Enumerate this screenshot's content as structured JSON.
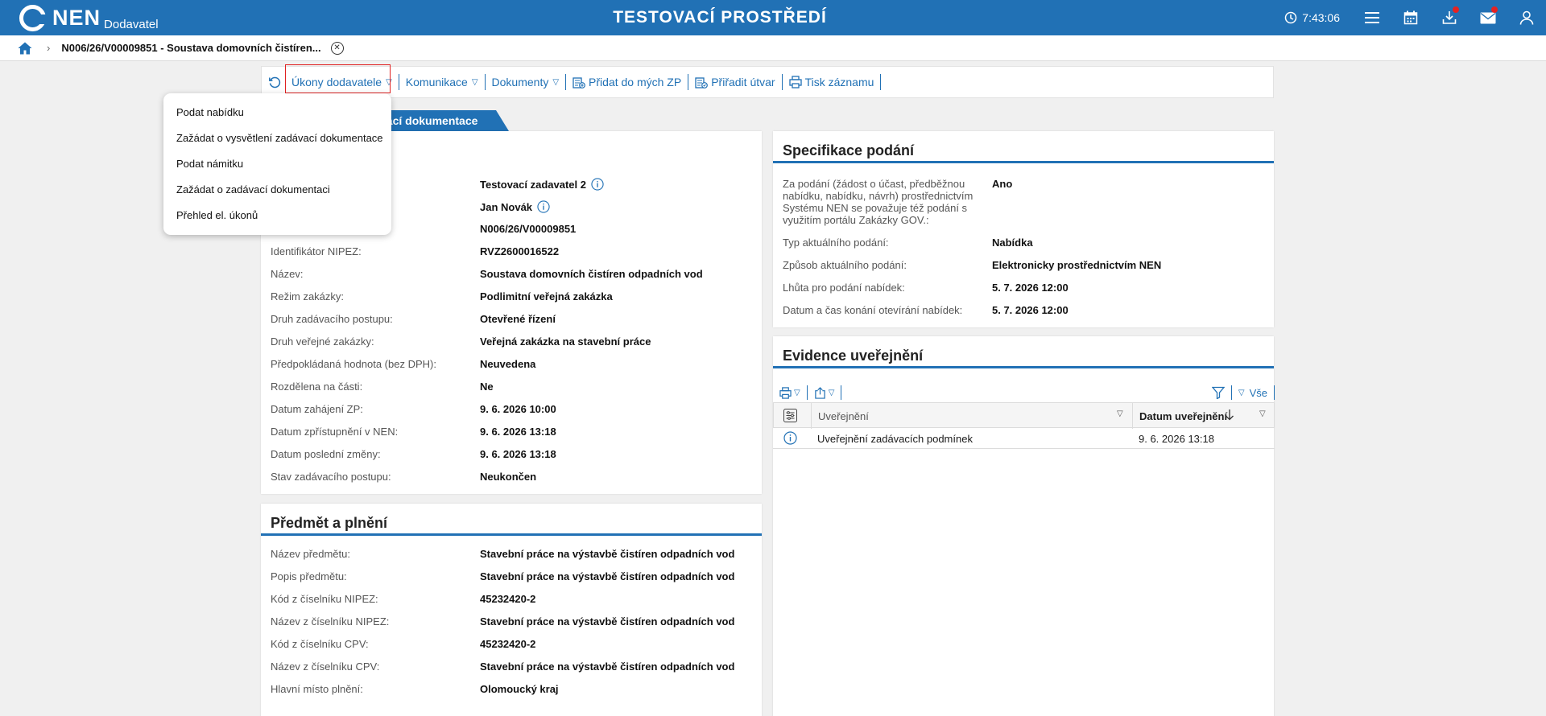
{
  "header": {
    "logo_text": "NEN",
    "logo_sub": "Dodavatel",
    "env_title": "TESTOVACÍ PROSTŘEDÍ",
    "time": "7:43:06",
    "colors": {
      "primary": "#2171b5",
      "badge": "#e52222"
    }
  },
  "breadcrumb": {
    "title": "N006/26/V00009851 - Soustava domovních čistíren..."
  },
  "toolbar": {
    "items": [
      {
        "label": "Úkony dodavatele",
        "icon": "none"
      },
      {
        "label": "Komunikace",
        "icon": "none"
      },
      {
        "label": "Dokumenty",
        "icon": "none"
      },
      {
        "label": "Přidat do mých ZP",
        "icon": "add-to-list-icon"
      },
      {
        "label": "Přiřadit útvar",
        "icon": "assign-unit-icon"
      },
      {
        "label": "Tisk záznamu",
        "icon": "print-icon"
      }
    ]
  },
  "tab": {
    "label": "vací dokumentace"
  },
  "menu": {
    "items": [
      "Podat nabídku",
      "Zažádat o vysvětlení zadávací dokumentace",
      "Podat námitku",
      "Zažádat o zadávací dokumentaci",
      "Přehled el. úkonů"
    ]
  },
  "main_panel": {
    "rows": [
      {
        "k": "",
        "v": "Testovací zadavatel 2"
      },
      {
        "k": "",
        "v": "Jan Novák"
      },
      {
        "k": "",
        "v": "N006/26/V00009851"
      },
      {
        "k": "Identifikátor NIPEZ:",
        "v": "RVZ2600016522"
      },
      {
        "k": "Název:",
        "v": "Soustava domovních čistíren odpadních vod"
      },
      {
        "k": "Režim zakázky:",
        "v": "Podlimitní veřejná zakázka"
      },
      {
        "k": "Druh zadávacího postupu:",
        "v": "Otevřené řízení"
      },
      {
        "k": "Druh veřejné zakázky:",
        "v": "Veřejná zakázka na stavební práce"
      },
      {
        "k": "Předpokládaná hodnota (bez DPH):",
        "v": "Neuvedena"
      },
      {
        "k": "Rozdělena na části:",
        "v": "Ne"
      },
      {
        "k": "Datum zahájení ZP:",
        "v": "9. 6. 2026 10:00"
      },
      {
        "k": "Datum zpřístupnění v NEN:",
        "v": "9. 6. 2026 13:18"
      },
      {
        "k": "Datum poslední změny:",
        "v": "9. 6. 2026 13:18"
      },
      {
        "k": "Stav zadávacího postupu:",
        "v": "Neukončen"
      }
    ]
  },
  "predmet": {
    "title": "Předmět a plnění",
    "rows": [
      {
        "k": "Název předmětu:",
        "v": "Stavební práce na výstavbě čistíren odpadních vod"
      },
      {
        "k": "Popis předmětu:",
        "v": "Stavební práce na výstavbě čistíren odpadních vod"
      },
      {
        "k": "Kód z číselníku NIPEZ:",
        "v": "45232420-2"
      },
      {
        "k": "Název z číselníku NIPEZ:",
        "v": "Stavební práce na výstavbě čistíren odpadních vod"
      },
      {
        "k": "Kód z číselníku CPV:",
        "v": "45232420-2"
      },
      {
        "k": "Název z číselníku CPV:",
        "v": "Stavební práce na výstavbě čistíren odpadních vod"
      },
      {
        "k": "Hlavní místo plnění:",
        "v": "Olomoucký kraj"
      }
    ]
  },
  "specifikace": {
    "title": "Specifikace podání",
    "first_key_lines": [
      "Za podání (žádost o účast, předběžnou",
      "nabídku, nabídku, návrh) prostřednictvím",
      "Systému NEN se považuje též podání s",
      "využitím portálu Zakázky GOV.:"
    ],
    "first_value": "Ano",
    "rows": [
      {
        "k": "Typ aktuálního podání:",
        "v": "Nabídka"
      },
      {
        "k": "Způsob aktuálního podání:",
        "v": "Elektronicky prostřednictvím NEN"
      },
      {
        "k": "Lhůta pro podání nabídek:",
        "v": "5. 7. 2026 12:00"
      },
      {
        "k": "Datum a čas konání otevírání nabídek:",
        "v": "5. 7. 2026 12:00"
      }
    ]
  },
  "evidence": {
    "title": "Evidence uveřejnění",
    "filter_all": "Vše",
    "columns": [
      "Uveřejnění",
      "Datum uveřejnění"
    ],
    "rows": [
      {
        "name": "Uveřejnění zadávacích podmínek",
        "date": "9. 6. 2026 13:18"
      }
    ]
  }
}
